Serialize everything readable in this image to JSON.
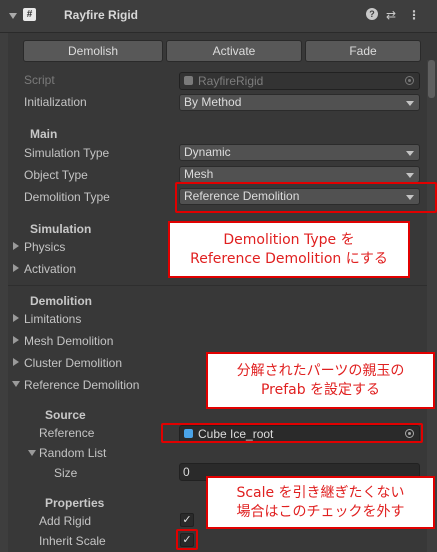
{
  "header": {
    "title": "Rayfire Rigid",
    "checkbox_mark": "✓",
    "component_icon": "#",
    "help_icon": "?",
    "settings_icon": "⇄",
    "menu_icon": "⋮"
  },
  "buttons": {
    "demolish": "Demolish",
    "activate": "Activate",
    "fade": "Fade"
  },
  "script": {
    "label": "Script",
    "value": "RayfireRigid"
  },
  "initialization": {
    "label": "Initialization",
    "value": "By Method"
  },
  "main": {
    "heading": "Main",
    "simulation_type": {
      "label": "Simulation Type",
      "value": "Dynamic"
    },
    "object_type": {
      "label": "Object Type",
      "value": "Mesh"
    },
    "demolition_type": {
      "label": "Demolition Type",
      "value": "Reference Demolition"
    }
  },
  "simulation": {
    "heading": "Simulation",
    "physics": "Physics",
    "activation": "Activation"
  },
  "demolition": {
    "heading": "Demolition",
    "limitations": "Limitations",
    "mesh": "Mesh Demolition",
    "cluster": "Cluster Demolition",
    "reference": "Reference Demolition"
  },
  "source": {
    "heading": "Source",
    "reference_label": "Reference",
    "reference_value": "Cube Ice_root",
    "random_list": "Random List",
    "size_label": "Size",
    "size_value": "0"
  },
  "properties": {
    "heading": "Properties",
    "add_rigid": "Add Rigid",
    "inherit_scale": "Inherit Scale",
    "check_mark": "✓"
  },
  "annotations": {
    "callout1": "Demolition Type を\nReference Demolition にする",
    "callout2": "分解されたパーツの親玉の\nPrefab を設定する",
    "callout3": "Scale を引き継ぎたくない\n場合はこのチェックを外す"
  },
  "colors": {
    "annotation_red": "#e10000",
    "annotation_text": "#e02020",
    "panel_bg": "#383838"
  }
}
